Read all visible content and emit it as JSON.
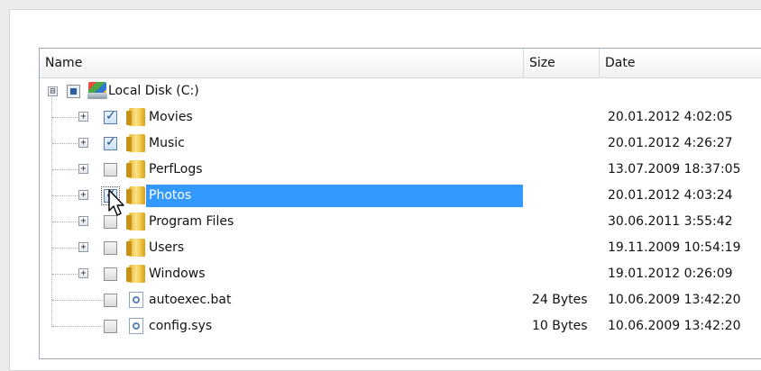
{
  "columns": {
    "name": "Name",
    "size": "Size",
    "date": "Date"
  },
  "root": {
    "label": "Local Disk (C:)",
    "expander": "⊟",
    "check_state": "partial"
  },
  "items": [
    {
      "label": "Movies",
      "icon": "folder-icon",
      "expander": "+",
      "checked": true,
      "size": "",
      "date": "20.01.2012 4:02:05"
    },
    {
      "label": "Music",
      "icon": "folder-icon",
      "expander": "+",
      "checked": true,
      "size": "",
      "date": "20.01.2012 4:26:27"
    },
    {
      "label": "PerfLogs",
      "icon": "folder-icon",
      "expander": "+",
      "checked": false,
      "size": "",
      "date": "13.07.2009 18:37:05"
    },
    {
      "label": "Photos",
      "icon": "folder-icon",
      "expander": "+",
      "checked": true,
      "selected": true,
      "size": "",
      "date": "20.01.2012 4:03:24"
    },
    {
      "label": "Program Files",
      "icon": "folder-icon",
      "expander": "+",
      "checked": false,
      "size": "",
      "date": "30.06.2011 3:55:42"
    },
    {
      "label": "Users",
      "icon": "folder-icon",
      "expander": "+",
      "checked": false,
      "size": "",
      "date": "19.11.2009 10:54:19"
    },
    {
      "label": "Windows",
      "icon": "folder-icon",
      "expander": "+",
      "checked": false,
      "size": "",
      "date": "19.01.2012 0:26:09"
    },
    {
      "label": "autoexec.bat",
      "icon": "batch-file-icon",
      "expander": "",
      "checked": false,
      "size": "24 Bytes",
      "date": "10.06.2009 13:42:20"
    },
    {
      "label": "config.sys",
      "icon": "system-file-icon",
      "expander": "",
      "checked": false,
      "size": "10 Bytes",
      "date": "10.06.2009 13:42:20"
    }
  ],
  "colors": {
    "selection": "#3399ff",
    "header_border": "#d7dbe1",
    "grid_border": "#9ca8b8"
  },
  "check_mark": "✓"
}
